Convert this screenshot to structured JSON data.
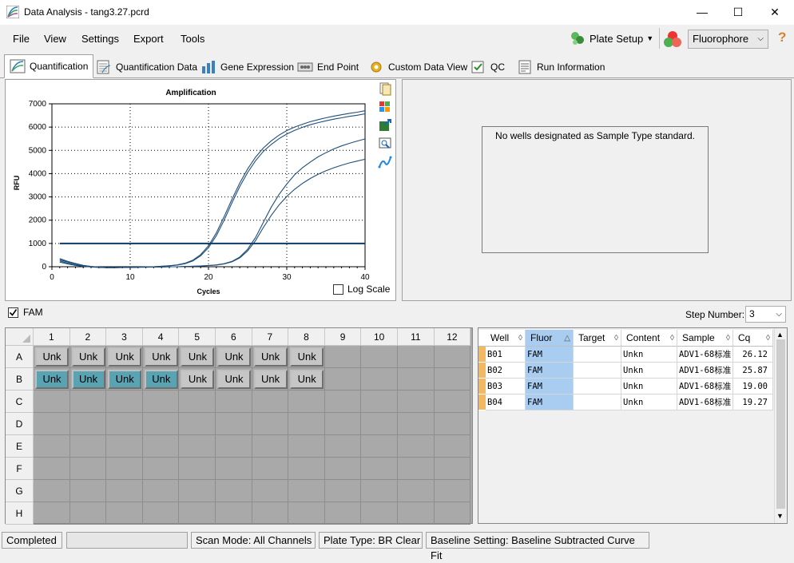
{
  "window": {
    "title": "Data Analysis - tang3.27.pcrd",
    "minimize": "—",
    "maximize": "☐",
    "close": "✕"
  },
  "menu": [
    "File",
    "View",
    "Settings",
    "Export",
    "Tools"
  ],
  "toolbar": {
    "plate_setup": "Plate Setup",
    "dropdown_value": "Fluorophore",
    "help": "?"
  },
  "tabs": [
    "Quantification",
    "Quantification Data",
    "Gene Expression",
    "End Point",
    "Custom Data View",
    "QC",
    "Run Information"
  ],
  "chart_data": {
    "type": "line",
    "title": "Amplification",
    "xlabel": "Cycles",
    "ylabel": "RFU",
    "xlim": [
      0,
      40
    ],
    "ylim": [
      0,
      7000
    ],
    "xticks": [
      0,
      10,
      20,
      30,
      40
    ],
    "yticks": [
      0,
      1000,
      2000,
      3000,
      4000,
      5000,
      6000,
      7000
    ],
    "threshold": 1000,
    "grid": true,
    "series": [
      {
        "x": [
          1,
          2,
          3,
          4,
          5,
          6,
          7,
          8,
          9,
          10,
          11,
          12,
          13,
          14,
          15,
          16,
          17,
          18,
          19,
          20,
          21,
          22,
          23,
          24,
          25,
          26,
          27,
          28,
          29,
          30,
          31,
          32,
          33,
          34,
          35,
          36,
          37,
          38,
          39,
          40
        ],
        "y": [
          250,
          150,
          80,
          30,
          0,
          -20,
          -40,
          -40,
          -30,
          -30,
          -20,
          -10,
          0,
          20,
          40,
          80,
          150,
          280,
          520,
          900,
          1450,
          2150,
          2900,
          3600,
          4200,
          4700,
          5100,
          5400,
          5650,
          5850,
          6000,
          6120,
          6230,
          6320,
          6400,
          6470,
          6530,
          6590,
          6640,
          6700
        ]
      },
      {
        "x": [
          1,
          2,
          3,
          4,
          5,
          6,
          7,
          8,
          9,
          10,
          11,
          12,
          13,
          14,
          15,
          16,
          17,
          18,
          19,
          20,
          21,
          22,
          23,
          24,
          25,
          26,
          27,
          28,
          29,
          30,
          31,
          32,
          33,
          34,
          35,
          36,
          37,
          38,
          39,
          40
        ],
        "y": [
          200,
          120,
          60,
          20,
          -10,
          -30,
          -40,
          -40,
          -30,
          -30,
          -20,
          -10,
          0,
          20,
          40,
          70,
          130,
          250,
          470,
          820,
          1330,
          2000,
          2750,
          3450,
          4050,
          4550,
          4950,
          5250,
          5500,
          5700,
          5860,
          5990,
          6100,
          6190,
          6270,
          6340,
          6400,
          6460,
          6510,
          6570
        ]
      },
      {
        "x": [
          1,
          2,
          3,
          4,
          5,
          6,
          7,
          8,
          9,
          10,
          11,
          12,
          13,
          14,
          15,
          16,
          17,
          18,
          19,
          20,
          21,
          22,
          23,
          24,
          25,
          26,
          27,
          28,
          29,
          30,
          31,
          32,
          33,
          34,
          35,
          36,
          37,
          38,
          39,
          40
        ],
        "y": [
          300,
          200,
          120,
          50,
          10,
          -20,
          -30,
          -30,
          -30,
          -30,
          -20,
          -20,
          -10,
          -10,
          0,
          0,
          10,
          20,
          30,
          50,
          80,
          130,
          230,
          420,
          750,
          1250,
          1900,
          2550,
          3100,
          3550,
          3950,
          4250,
          4500,
          4720,
          4900,
          5060,
          5190,
          5300,
          5400,
          5490
        ]
      },
      {
        "x": [
          1,
          2,
          3,
          4,
          5,
          6,
          7,
          8,
          9,
          10,
          11,
          12,
          13,
          14,
          15,
          16,
          17,
          18,
          19,
          20,
          21,
          22,
          23,
          24,
          25,
          26,
          27,
          28,
          29,
          30,
          31,
          32,
          33,
          34,
          35,
          36,
          37,
          38,
          39,
          40
        ],
        "y": [
          350,
          230,
          140,
          60,
          10,
          -20,
          -30,
          -30,
          -30,
          -30,
          -20,
          -20,
          -10,
          -10,
          0,
          0,
          10,
          20,
          30,
          50,
          70,
          120,
          210,
          380,
          680,
          1120,
          1680,
          2200,
          2650,
          3020,
          3330,
          3580,
          3790,
          3970,
          4120,
          4250,
          4360,
          4460,
          4540,
          4620
        ]
      }
    ]
  },
  "chart_side_icons": [
    "copy-icon",
    "color-icon",
    "export-icon",
    "zoom-icon",
    "curve-icon"
  ],
  "log_scale_label": "Log Scale",
  "standard_message": "No wells designated as Sample Type standard.",
  "fam_label": "FAM",
  "step_number": {
    "label": "Step Number:",
    "value": "3"
  },
  "plate": {
    "columns": [
      "1",
      "2",
      "3",
      "4",
      "5",
      "6",
      "7",
      "8",
      "9",
      "10",
      "11",
      "12"
    ],
    "rows": [
      "A",
      "B",
      "C",
      "D",
      "E",
      "F",
      "G",
      "H"
    ],
    "wells": [
      {
        "row": 0,
        "col": 0,
        "label": "Unk",
        "selected": false
      },
      {
        "row": 0,
        "col": 1,
        "label": "Unk",
        "selected": false
      },
      {
        "row": 0,
        "col": 2,
        "label": "Unk",
        "selected": false
      },
      {
        "row": 0,
        "col": 3,
        "label": "Unk",
        "selected": false
      },
      {
        "row": 0,
        "col": 4,
        "label": "Unk",
        "selected": false
      },
      {
        "row": 0,
        "col": 5,
        "label": "Unk",
        "selected": false
      },
      {
        "row": 0,
        "col": 6,
        "label": "Unk",
        "selected": false
      },
      {
        "row": 0,
        "col": 7,
        "label": "Unk",
        "selected": false
      },
      {
        "row": 1,
        "col": 0,
        "label": "Unk",
        "selected": true
      },
      {
        "row": 1,
        "col": 1,
        "label": "Unk",
        "selected": true
      },
      {
        "row": 1,
        "col": 2,
        "label": "Unk",
        "selected": true
      },
      {
        "row": 1,
        "col": 3,
        "label": "Unk",
        "selected": true
      },
      {
        "row": 1,
        "col": 4,
        "label": "Unk",
        "selected": false
      },
      {
        "row": 1,
        "col": 5,
        "label": "Unk",
        "selected": false
      },
      {
        "row": 1,
        "col": 6,
        "label": "Unk",
        "selected": false
      },
      {
        "row": 1,
        "col": 7,
        "label": "Unk",
        "selected": false
      }
    ]
  },
  "table": {
    "headers": [
      "Well",
      "Fluor",
      "Target",
      "Content",
      "Sample",
      "Cq"
    ],
    "rows": [
      [
        "B01",
        "FAM",
        "",
        "Unkn",
        "ADV1-68标准",
        "26.12"
      ],
      [
        "B02",
        "FAM",
        "",
        "Unkn",
        "ADV1-68标准",
        "25.87"
      ],
      [
        "B03",
        "FAM",
        "",
        "Unkn",
        "ADV1-68标准",
        "19.00"
      ],
      [
        "B04",
        "FAM",
        "",
        "Unkn",
        "ADV1-68标准",
        "19.27"
      ]
    ]
  },
  "status": {
    "completed": "Completed",
    "scan_mode": "Scan Mode: All Channels",
    "plate_type": "Plate Type: BR Clear",
    "baseline": "Baseline Setting: Baseline Subtracted Curve Fit"
  }
}
